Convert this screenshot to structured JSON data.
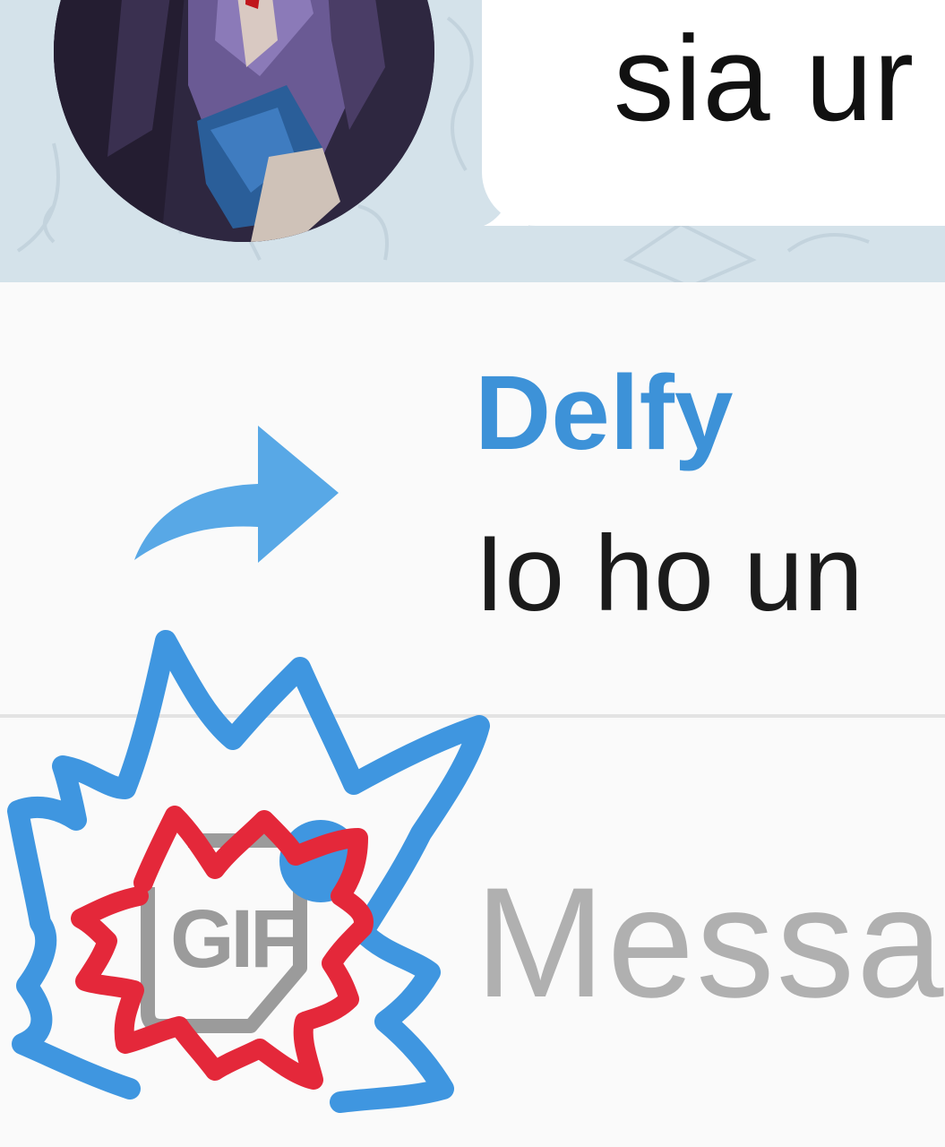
{
  "message": {
    "text": "sia ur"
  },
  "reply": {
    "author": "Delfy",
    "text": "Io ho un"
  },
  "composer": {
    "gif_label": "GIF",
    "placeholder": "Messa"
  },
  "colors": {
    "accent": "#3d92d8",
    "reply_icon": "#58a8e6",
    "scribble_outer": "#3f96e0",
    "scribble_inner": "#e4283a",
    "chat_background": "#d4e2ea"
  },
  "icons": {
    "reply": "reply-arrow-icon",
    "gif": "gif-icon"
  }
}
